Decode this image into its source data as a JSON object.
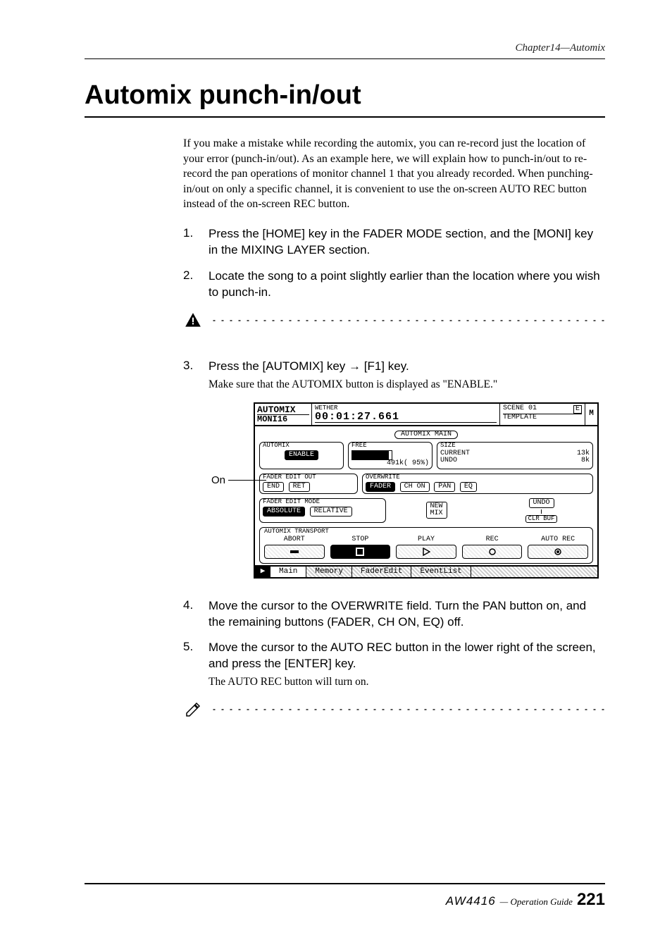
{
  "header": {
    "chapter": "Chapter14—Automix"
  },
  "title": "Automix punch-in/out",
  "intro": "If you make a mistake while recording the automix, you can re-record just the location of your error (punch-in/out). As an example here, we will explain how to punch-in/out to re-record the pan operations of monitor channel 1 that you already recorded. When punching-in/out on only a specific channel, it is convenient to use the on-screen AUTO REC button instead of the on-screen REC button.",
  "steps": {
    "s1": {
      "num": "1.",
      "text": "Press the [HOME] key in the FADER MODE section, and the [MONI] key in the MIXING LAYER section."
    },
    "s2": {
      "num": "2.",
      "text": "Locate the song to a point slightly earlier than the location where you wish to punch-in."
    },
    "s3": {
      "num": "3.",
      "text": "Press the [AUTOMIX] key → [F1] key.",
      "sub": "Make sure that the AUTOMIX button is displayed as \"ENABLE.\""
    },
    "s4": {
      "num": "4.",
      "text": "Move the cursor to the OVERWRITE field. Turn the PAN button on, and the remaining buttons (FADER, CH ON, EQ) off."
    },
    "s5": {
      "num": "5.",
      "text": "Move the cursor to the AUTO REC button in the lower right of the screen, and press the [ENTER] key.",
      "sub": "The AUTO REC button will turn on."
    }
  },
  "on_label": "On",
  "screen": {
    "top": {
      "title1": "AUTOMIX",
      "title2": "MONI16",
      "mid_label": "WETHER",
      "timecode": "00:01:27.661",
      "scene_label": "SCENE 01",
      "scene_e": "E",
      "template": "TEMPLATE",
      "m": "M"
    },
    "main_label": "AUTOMIX MAIN",
    "automix": {
      "label": "AUTOMIX",
      "btn": "ENABLE"
    },
    "free": {
      "label": "FREE",
      "value": "491k( 95%)"
    },
    "size": {
      "label": "SIZE",
      "current_lbl": "CURRENT",
      "current_val": "13k",
      "undo_lbl": "UNDO",
      "undo_val": "8k"
    },
    "fader_edit_out": {
      "label": "FADER EDIT OUT",
      "end": "END",
      "ret": "RET"
    },
    "overwrite": {
      "label": "OVERWRITE",
      "fader": "FADER",
      "chon": "CH ON",
      "pan": "PAN",
      "eq": "EQ"
    },
    "fader_edit_mode": {
      "label": "FADER EDIT MODE",
      "absolute": "ABSOLUTE",
      "relative": "RELATIVE"
    },
    "newmix": "NEW\nMIX",
    "undo": {
      "btn": "UNDO",
      "clr": "CLR BUF"
    },
    "transport": {
      "label": "AUTOMIX TRANSPORT",
      "abort": "ABORT",
      "stop": "STOP",
      "play": "PLAY",
      "rec": "REC",
      "autorec": "AUTO REC"
    },
    "tabs": {
      "main": "Main",
      "memory": "Memory",
      "faderedit": "FaderEdit",
      "eventlist": "EventList"
    }
  },
  "footer": {
    "logo": "AW4416",
    "guide": "— Operation Guide",
    "page": "221"
  }
}
